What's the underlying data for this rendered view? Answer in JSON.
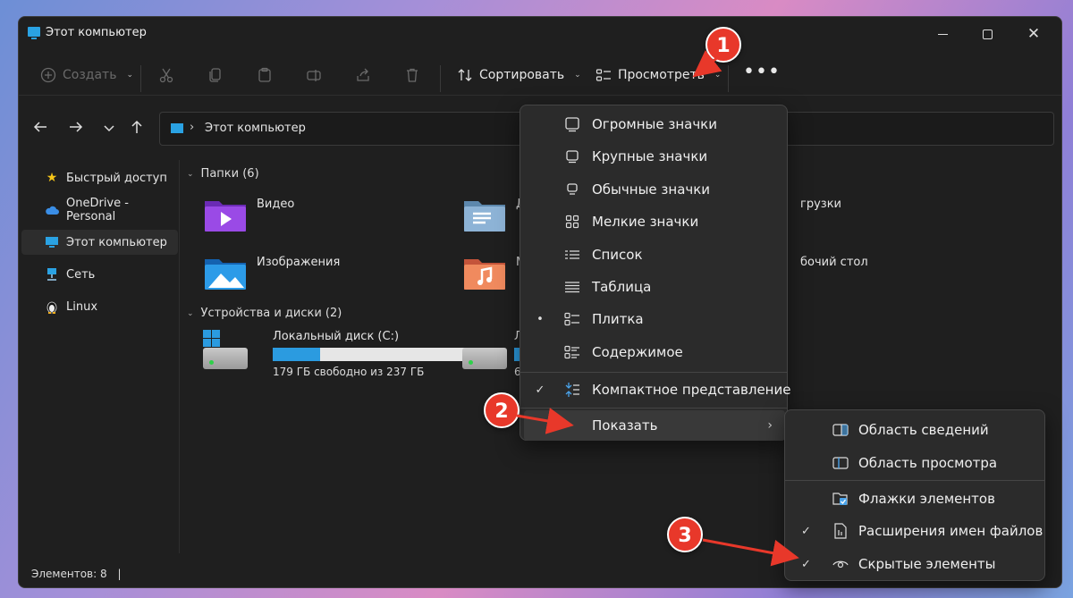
{
  "window": {
    "title": "Этот компьютер"
  },
  "toolbar": {
    "create_label": "Создать",
    "sort_label": "Сортировать",
    "view_label": "Просмотреть"
  },
  "address": {
    "path": "Этот компьютер"
  },
  "sidebar": {
    "items": [
      {
        "label": "Быстрый доступ",
        "icon": "star-icon"
      },
      {
        "label": "OneDrive - Personal",
        "icon": "cloud-icon"
      },
      {
        "label": "Этот компьютер",
        "icon": "monitor-icon",
        "active": true
      },
      {
        "label": "Сеть",
        "icon": "network-icon"
      },
      {
        "label": "Linux",
        "icon": "penguin-icon"
      }
    ]
  },
  "content": {
    "folders_header": "Папки (6)",
    "folders": [
      {
        "label": "Видео",
        "icon": "video-folder-icon",
        "color": "#8a3ed6"
      },
      {
        "label": "Д",
        "icon": "documents-folder-icon",
        "color": "#7fa7c8"
      },
      {
        "label": "грузки",
        "icon": "downloads-folder-icon"
      },
      {
        "label": "Изображения",
        "icon": "pictures-folder-icon",
        "color": "#1f8be0"
      },
      {
        "label": "М",
        "icon": "music-folder-icon",
        "color": "#e8774f"
      },
      {
        "label": "бочий стол",
        "icon": "desktop-folder-icon"
      }
    ],
    "devices_header": "Устройства и диски (2)",
    "drives": [
      {
        "label": "Локальный диск (C:)",
        "free": "179 ГБ свободно из 237 ГБ",
        "used_fraction": 0.245
      },
      {
        "label": "Л",
        "free": "6",
        "used_fraction": 0.1
      }
    ]
  },
  "status": {
    "count": "Элементов: 8"
  },
  "view_menu": {
    "items": [
      {
        "label": "Огромные значки",
        "icon": "huge-icons-icon",
        "mark": ""
      },
      {
        "label": "Крупные значки",
        "icon": "large-icons-icon",
        "mark": ""
      },
      {
        "label": "Обычные значки",
        "icon": "medium-icons-icon",
        "mark": ""
      },
      {
        "label": "Мелкие значки",
        "icon": "small-icons-icon",
        "mark": ""
      },
      {
        "label": "Список",
        "icon": "list-icon",
        "mark": ""
      },
      {
        "label": "Таблица",
        "icon": "details-icon",
        "mark": ""
      },
      {
        "label": "Плитка",
        "icon": "tiles-icon",
        "mark": "•"
      },
      {
        "label": "Содержимое",
        "icon": "content-icon",
        "mark": ""
      },
      {
        "label": "Компактное представление",
        "icon": "compact-icon",
        "mark": "✓"
      },
      {
        "label": "Показать",
        "icon": "",
        "mark": "",
        "submenu": true
      }
    ]
  },
  "show_menu": {
    "items": [
      {
        "label": "Область сведений",
        "icon": "details-pane-icon",
        "mark": ""
      },
      {
        "label": "Область просмотра",
        "icon": "preview-pane-icon",
        "mark": ""
      },
      {
        "label": "Флажки элементов",
        "icon": "checkbox-icon",
        "mark": ""
      },
      {
        "label": "Расширения имен файлов",
        "icon": "file-ext-icon",
        "mark": "✓"
      },
      {
        "label": "Скрытые элементы",
        "icon": "eye-icon",
        "mark": "✓"
      }
    ]
  },
  "annotations": {
    "badge1": "1",
    "badge2": "2",
    "badge3": "3",
    "color": "#e8382a"
  }
}
